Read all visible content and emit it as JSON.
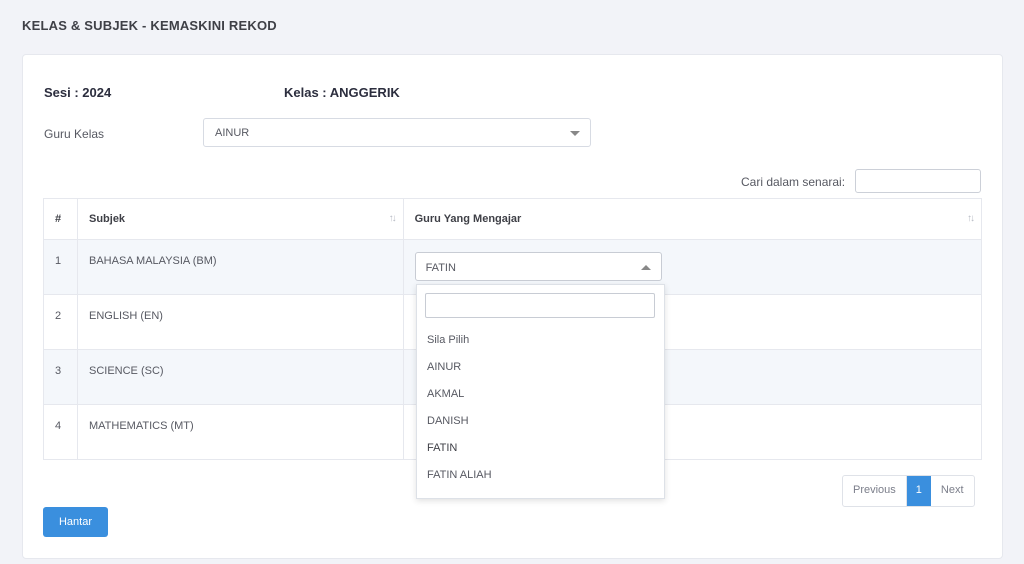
{
  "header": {
    "title": "KELAS & SUBJEK - KEMASKINI REKOD"
  },
  "form": {
    "sesi": "Sesi : 2024",
    "kelas": "Kelas : ANGGERIK",
    "guru_kelas_label": "Guru Kelas",
    "guru_kelas_value": "AINUR"
  },
  "search": {
    "label": "Cari dalam senarai:",
    "value": ""
  },
  "table": {
    "columns": [
      "#",
      "Subjek",
      "Guru Yang Mengajar"
    ],
    "rows": [
      {
        "no": "1",
        "subject": "BAHASA MALAYSIA (BM)",
        "teacher": "FATIN"
      },
      {
        "no": "2",
        "subject": "ENGLISH (EN)",
        "teacher": ""
      },
      {
        "no": "3",
        "subject": "SCIENCE (SC)",
        "teacher": ""
      },
      {
        "no": "4",
        "subject": "MATHEMATICS (MT)",
        "teacher": ""
      }
    ]
  },
  "dropdown": {
    "search_value": "",
    "options": [
      "Sila Pilih",
      "AINUR",
      "AKMAL",
      "DANISH",
      "FATIN",
      "FATIN ALIAH"
    ],
    "selected": "FATIN"
  },
  "pagination": {
    "previous": "Previous",
    "current": "1",
    "next": "Next"
  },
  "actions": {
    "submit": "Hantar"
  },
  "colors": {
    "primary": "#3a8fde",
    "row_alt": "#f4f7fb",
    "background": "#f2f3f8"
  },
  "icons": {
    "sort": "sort-arrows-icon",
    "caret_down": "caret-down-icon",
    "caret_up": "caret-up-icon"
  }
}
